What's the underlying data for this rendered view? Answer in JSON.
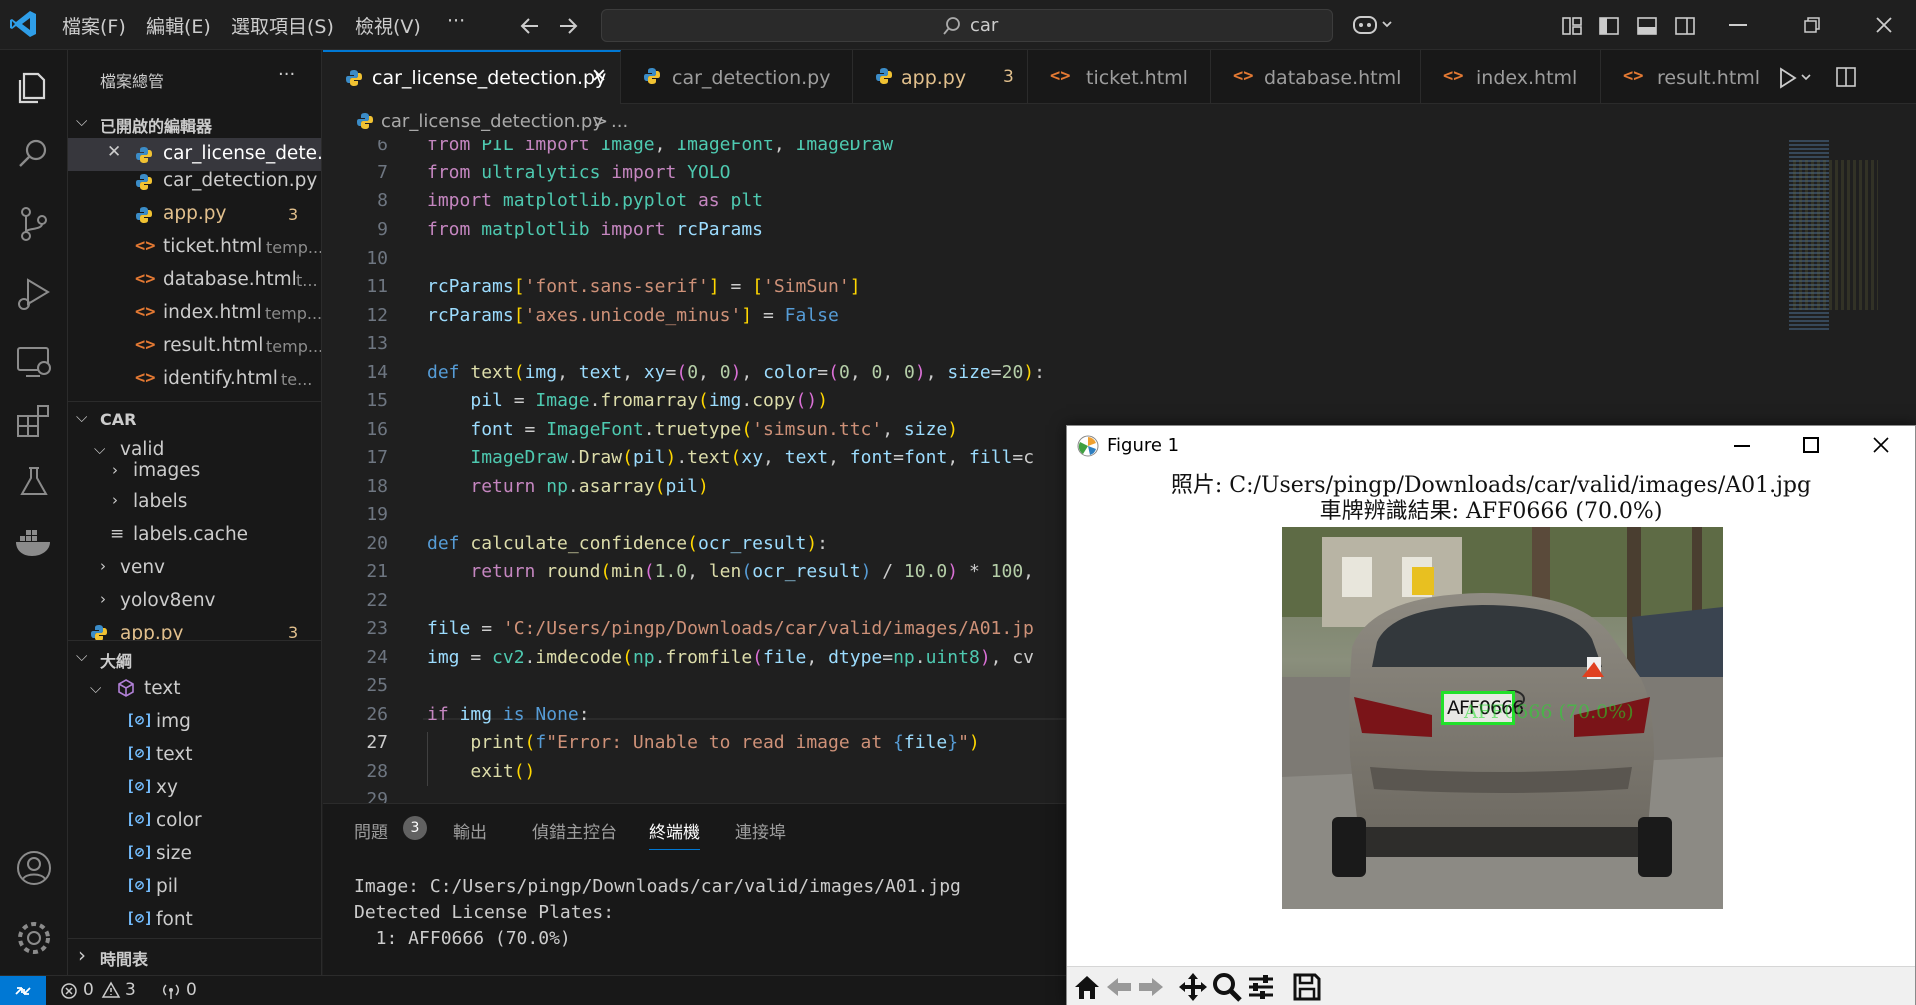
{
  "titlebar": {
    "menus": [
      "檔案(F)",
      "編輯(E)",
      "選取項目(S)",
      "檢視(V)"
    ],
    "more": "···",
    "search_text": "car"
  },
  "sidebar": {
    "title": "檔案總管",
    "more": "···",
    "open_editors_title": "已開啟的編輯器",
    "open_editors": [
      {
        "name": "car_license_dete...",
        "hint": "",
        "badge": "",
        "modified": false
      },
      {
        "name": "car_detection.py",
        "hint": "",
        "badge": "",
        "modified": false
      },
      {
        "name": "app.py",
        "hint": "",
        "badge": "3",
        "modified": true
      },
      {
        "name": "ticket.html",
        "hint": "temp...",
        "badge": "",
        "modified": false
      },
      {
        "name": "database.html",
        "hint": "t...",
        "badge": "",
        "modified": false
      },
      {
        "name": "index.html",
        "hint": "temp...",
        "badge": "",
        "modified": false
      },
      {
        "name": "result.html",
        "hint": "temp...",
        "badge": "",
        "modified": false
      },
      {
        "name": "identify.html",
        "hint": "te...",
        "badge": "",
        "modified": false
      }
    ],
    "folder_title": "CAR",
    "tree": [
      {
        "name": "valid",
        "expanded": true
      },
      {
        "name": "images",
        "expanded": false
      },
      {
        "name": "labels",
        "expanded": false
      },
      {
        "name": "labels.cache",
        "file": true
      },
      {
        "name": "venv",
        "expanded": false
      },
      {
        "name": "yolov8env",
        "expanded": false
      },
      {
        "name": "app.py",
        "badge": "3"
      }
    ],
    "outline_title": "大綱",
    "outline_root": "text",
    "outline_items": [
      "img",
      "text",
      "xy",
      "color",
      "size",
      "pil",
      "font"
    ],
    "timeline_title": "時間表"
  },
  "tabs": [
    {
      "label": "car_license_detection.py",
      "active": true,
      "badge": "",
      "close": "✕"
    },
    {
      "label": "car_detection.py",
      "active": false,
      "badge": ""
    },
    {
      "label": "app.py",
      "active": false,
      "badge": "3"
    },
    {
      "label": "ticket.html",
      "active": false,
      "badge": ""
    },
    {
      "label": "database.html",
      "active": false,
      "badge": ""
    },
    {
      "label": "index.html",
      "active": false,
      "badge": ""
    },
    {
      "label": "result.html",
      "active": false,
      "badge": ""
    }
  ],
  "breadcrumb": {
    "file": "car_license_detection.py",
    "sep": ">",
    "more": "..."
  },
  "editor": {
    "line_numbers": [
      "6",
      "7",
      "8",
      "9",
      "10",
      "11",
      "12",
      "13",
      "14",
      "15",
      "16",
      "17",
      "18",
      "19",
      "20",
      "21",
      "22",
      "23",
      "24",
      "25",
      "26",
      "27",
      "28",
      "29"
    ],
    "current_line": "27"
  },
  "panel": {
    "tabs": [
      "問題",
      "輸出",
      "偵錯主控台",
      "終端機",
      "連接埠"
    ],
    "problems_count": "3",
    "active_tab": "終端機",
    "terminal_lines": [
      "Image: C:/Users/pingp/Downloads/car/valid/images/A01.jpg",
      "Detected License Plates:",
      "  1: AFF0666 (70.0%)"
    ]
  },
  "status": {
    "errors": "0",
    "warnings": "3",
    "ports": "0"
  },
  "figure": {
    "window_title": "Figure 1",
    "caption_line1": "照片: C:/Users/pingp/Downloads/car/valid/images/A01.jpg",
    "caption_line2": "車牌辨識結果: AFF0666 (70.0%)",
    "plate_text": "AFF0666",
    "overlay_label": "AFF0666 (70.0%)"
  },
  "colors": {
    "accent": "#0078d4",
    "detect_box": "#22e02a",
    "modified": "#e2c08d"
  }
}
